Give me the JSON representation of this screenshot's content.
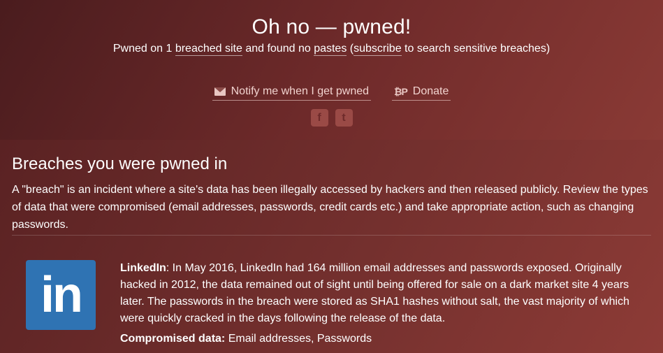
{
  "header": {
    "title": "Oh no — pwned!",
    "subtitle": {
      "prefix": "Pwned on 1 ",
      "breached_site": "breached site",
      "middle": " and found no ",
      "pastes": "pastes",
      "paren_open": " (",
      "subscribe": "subscribe",
      "suffix": " to search sensitive breaches)"
    },
    "actions": {
      "notify_label": "Notify me when I get pwned",
      "notify_icon": "envelope-icon",
      "donate_label": "Donate",
      "donate_icon": "bitcoin-paypal-icon"
    },
    "social": {
      "facebook": "f",
      "twitter": "t"
    }
  },
  "breaches": {
    "title": "Breaches you were pwned in",
    "description": "A \"breach\" is an incident where a site's data has been illegally accessed by hackers and then released publicly. Review the types of data that were compromised (email addresses, passwords, credit cards etc.) and take appropriate action, such as changing passwords.",
    "items": [
      {
        "logo_text": "in",
        "name": "LinkedIn",
        "description": ": In May 2016, LinkedIn had 164 million email addresses and passwords exposed. Originally hacked in 2012, the data remained out of sight until being offered for sale on a dark market site 4 years later. The passwords in the breach were stored as SHA1 hashes without salt, the vast majority of which were quickly cracked in the days following the release of the data.",
        "compromised_label": "Compromised data:",
        "compromised_value": " Email addresses, Passwords"
      }
    ]
  },
  "colors": {
    "linkedin_blue": "#2f73b3",
    "background": "#6e2a2a"
  }
}
